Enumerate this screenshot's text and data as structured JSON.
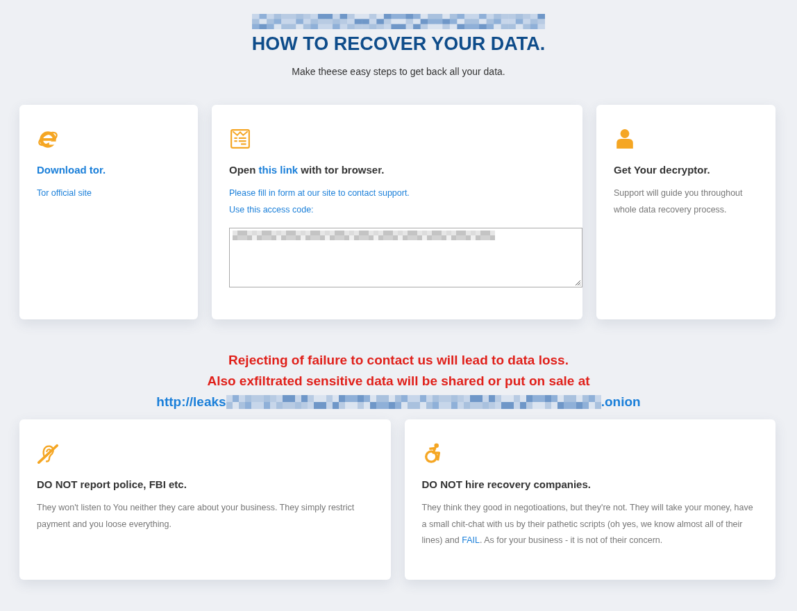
{
  "header": {
    "title": "HOW TO RECOVER YOUR DATA.",
    "subtitle": "Make theese easy steps to get back all your data."
  },
  "steps": [
    {
      "kind": "ie",
      "title": [
        {
          "text": "Download tor.",
          "kind": "link"
        }
      ],
      "body": [
        [
          {
            "text": "Tor official site",
            "kind": "link"
          }
        ]
      ]
    },
    {
      "kind": "form",
      "title": [
        {
          "text": "Open ",
          "kind": "text"
        },
        {
          "text": "this link",
          "kind": "link"
        },
        {
          "text": " with tor browser.",
          "kind": "text"
        }
      ],
      "body": [
        [
          {
            "text": "Please fill in form at our site to contact support.",
            "kind": "link"
          }
        ],
        [
          {
            "text": "Use this access code:",
            "kind": "link"
          }
        ]
      ],
      "access_code_field": true
    },
    {
      "kind": "user",
      "title": [
        {
          "text": "Get Your decryptor.",
          "kind": "text"
        }
      ],
      "body": [
        [
          {
            "text": "Support will guide you throughout whole data recovery process.",
            "kind": "text"
          }
        ]
      ]
    }
  ],
  "warning": {
    "lines": [
      "Rejecting of failure to contact us will lead to data loss.",
      "Also exfiltrated sensitive data will be shared or put on sale at"
    ],
    "url_start": "http://leaks",
    "url_end": ".onion"
  },
  "notes": [
    {
      "kind": "ear",
      "title": [
        {
          "text": "DO NOT report police, FBI etc.",
          "kind": "text"
        }
      ],
      "body": [
        [
          {
            "text": "They won't listen to You neither they care about your business. They simply restrict payment and you loose everything.",
            "kind": "text"
          }
        ]
      ]
    },
    {
      "kind": "wheelchair",
      "title": [
        {
          "text": "DO NOT hire recovery companies.",
          "kind": "text"
        }
      ],
      "body": [
        [
          {
            "text": "They think they good in negotioations, but they're not. They will take your money, have a small chit-chat with us by their pathetic scripts (oh yes, we know almost all of their lines) and ",
            "kind": "text"
          },
          {
            "text": "FAIL",
            "kind": "link"
          },
          {
            "text": ". As for your business - it is not of their concern.",
            "kind": "text"
          }
        ]
      ]
    }
  ]
}
